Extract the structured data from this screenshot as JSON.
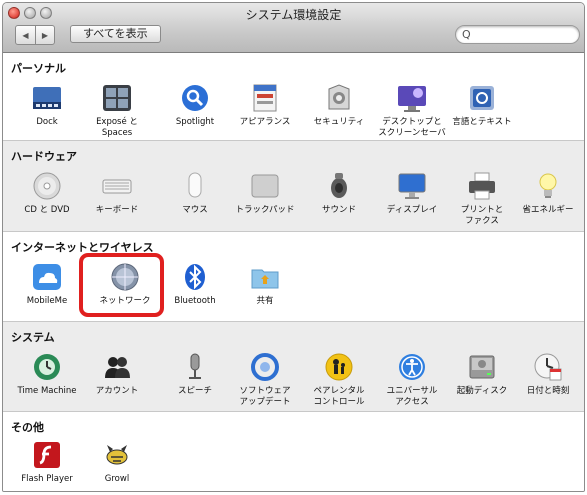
{
  "window": {
    "title": "システム環境設定",
    "show_all_label": "すべてを表示",
    "nav_back_glyph": "◀",
    "nav_forward_glyph": "▶",
    "search_glyph": "Q"
  },
  "sections": {
    "personal": {
      "title": "パーソナル",
      "items": [
        {
          "label": "Dock",
          "icon": "dock-icon"
        },
        {
          "label": "Exposé と\nSpaces",
          "icon": "expose-icon"
        },
        {
          "label": "Spotlight",
          "icon": "spotlight-icon"
        },
        {
          "label": "アピアランス",
          "icon": "appearance-icon"
        },
        {
          "label": "セキュリティ",
          "icon": "security-icon"
        },
        {
          "label": "デスクトップと\nスクリーンセーバ",
          "icon": "desktop-icon"
        },
        {
          "label": "言語とテキスト",
          "icon": "language-icon"
        }
      ]
    },
    "hardware": {
      "title": "ハードウェア",
      "items": [
        {
          "label": "CD と DVD",
          "icon": "cd-dvd-icon"
        },
        {
          "label": "キーボード",
          "icon": "keyboard-icon"
        },
        {
          "label": "マウス",
          "icon": "mouse-icon"
        },
        {
          "label": "トラックパッド",
          "icon": "trackpad-icon"
        },
        {
          "label": "サウンド",
          "icon": "sound-icon"
        },
        {
          "label": "ディスプレイ",
          "icon": "display-icon"
        },
        {
          "label": "プリントと\nファクス",
          "icon": "print-icon"
        },
        {
          "label": "省エネルギー",
          "icon": "energy-icon"
        }
      ]
    },
    "internet": {
      "title": "インターネットとワイヤレス",
      "items": [
        {
          "label": "MobileMe",
          "icon": "mobileme-icon"
        },
        {
          "label": "ネットワーク",
          "icon": "network-icon"
        },
        {
          "label": "Bluetooth",
          "icon": "bluetooth-icon"
        },
        {
          "label": "共有",
          "icon": "sharing-icon"
        }
      ]
    },
    "system": {
      "title": "システム",
      "items": [
        {
          "label": "Time Machine",
          "icon": "time-machine-icon"
        },
        {
          "label": "アカウント",
          "icon": "accounts-icon"
        },
        {
          "label": "スピーチ",
          "icon": "speech-icon"
        },
        {
          "label": "ソフトウェア\nアップデート",
          "icon": "software-update-icon"
        },
        {
          "label": "ペアレンタル\nコントロール",
          "icon": "parental-controls-icon"
        },
        {
          "label": "ユニバーサル\nアクセス",
          "icon": "universal-access-icon"
        },
        {
          "label": "起動ディスク",
          "icon": "startup-disk-icon"
        },
        {
          "label": "日付と時刻",
          "icon": "date-time-icon"
        }
      ]
    },
    "other": {
      "title": "その他",
      "items": [
        {
          "label": "Flash Player",
          "icon": "flash-player-icon"
        },
        {
          "label": "Growl",
          "icon": "growl-icon"
        }
      ]
    }
  },
  "colors": {
    "highlight": "#e0201f",
    "accent_blue": "#2b6fd6"
  }
}
